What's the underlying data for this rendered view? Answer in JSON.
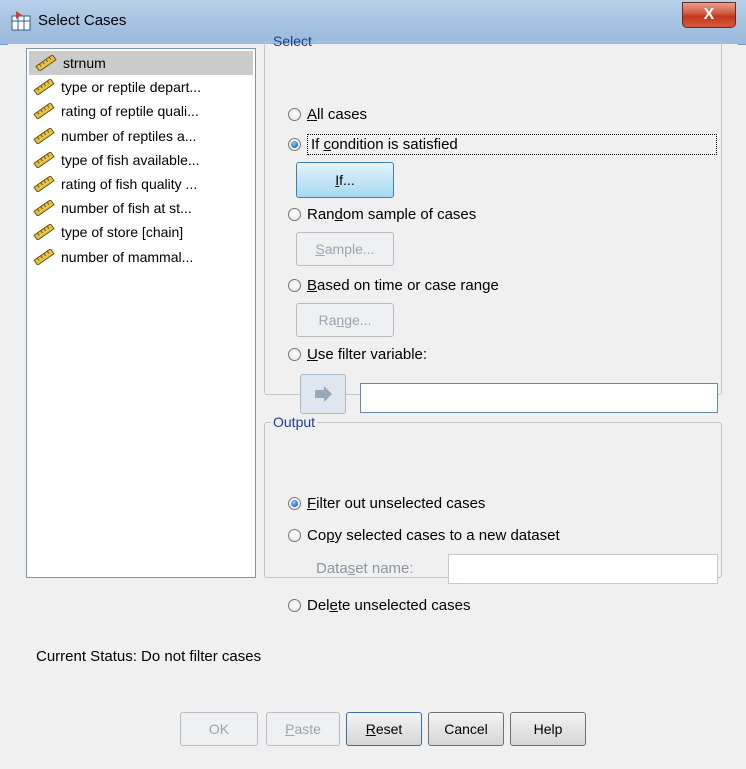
{
  "window": {
    "title": "Select Cases",
    "close_label": "X"
  },
  "variables": [
    "strnum",
    "type or reptile depart...",
    "rating of reptile quali...",
    "number of reptiles a...",
    "type of fish available...",
    "rating of fish quality ...",
    "number of fish at st...",
    "type of store [chain]",
    "number of mammal..."
  ],
  "select": {
    "legend": "Select",
    "all_cases": {
      "pre": "",
      "key": "A",
      "post": "ll cases"
    },
    "if_condition": {
      "pre": "If ",
      "key": "c",
      "post": "ondition is satisfied"
    },
    "if_button": {
      "pre": "",
      "key": "I",
      "post": "f..."
    },
    "random_sample": {
      "pre": "Ran",
      "key": "d",
      "post": "om sample of cases"
    },
    "sample_button": {
      "pre": "",
      "key": "S",
      "post": "ample..."
    },
    "time_range": {
      "pre": "",
      "key": "B",
      "post": "ased on time or case range"
    },
    "range_button": {
      "pre": "Ra",
      "key": "n",
      "post": "ge..."
    },
    "filter_var": {
      "pre": "",
      "key": "U",
      "post": "se filter variable:"
    },
    "filter_value": ""
  },
  "output": {
    "legend": "Output",
    "filter_out": {
      "pre": "",
      "key": "F",
      "post": "ilter out unselected cases"
    },
    "copy": {
      "pre": "Co",
      "key": "p",
      "post": "y selected cases to a new dataset"
    },
    "dataset_name": {
      "pre": "Data",
      "key": "s",
      "post": "et name:"
    },
    "dataset_value": "",
    "delete": {
      "pre": "Del",
      "key": "e",
      "post": "te unselected cases"
    }
  },
  "status": "Current Status: Do not filter cases",
  "buttons": {
    "ok": "OK",
    "paste": {
      "pre": "",
      "key": "P",
      "post": "aste"
    },
    "reset": {
      "pre": "",
      "key": "R",
      "post": "eset"
    },
    "cancel": "Cancel",
    "help": "Help"
  },
  "colors": {
    "accent": "#1f6ec4",
    "legend": "#1e3d8e",
    "titlebar": "#a8c4e2"
  }
}
